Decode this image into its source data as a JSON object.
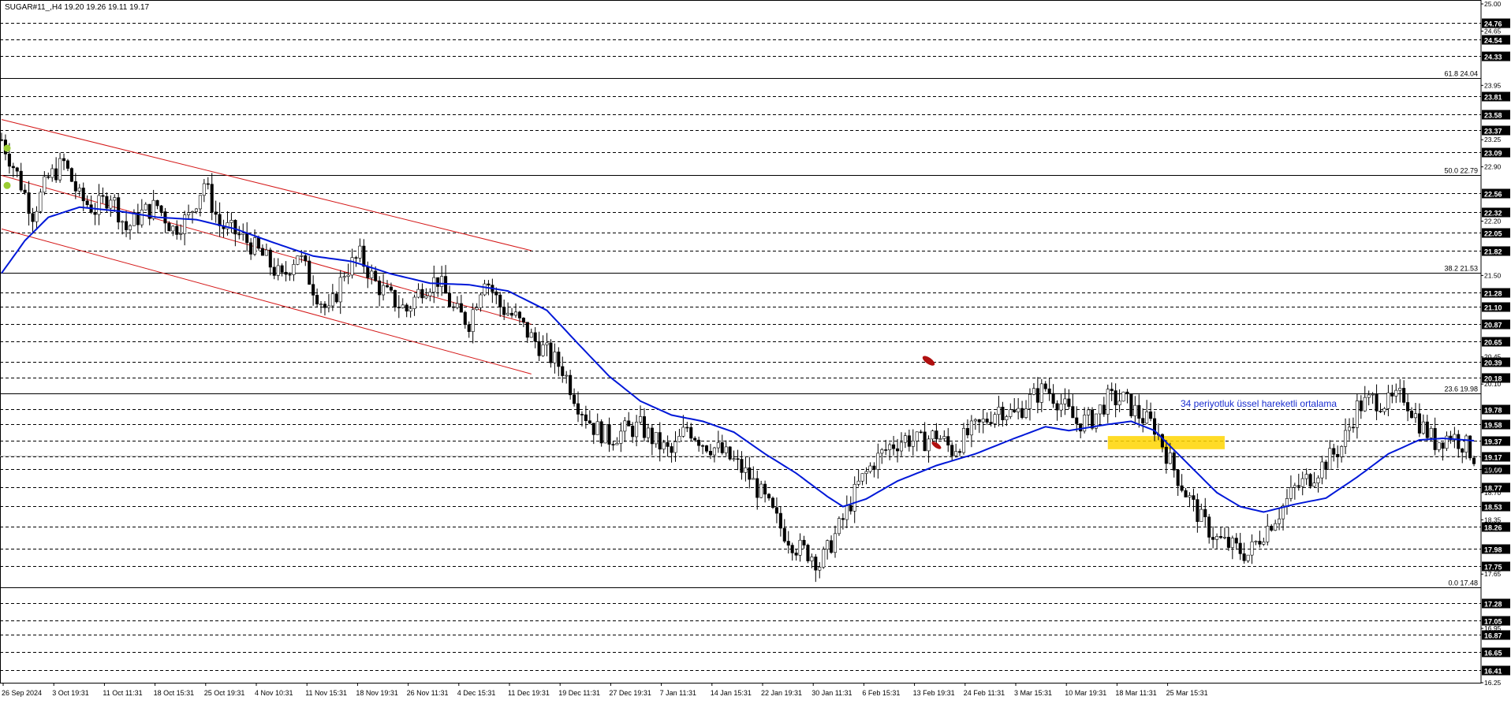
{
  "header": {
    "symbol_info": "SUGAR#11_,H4  19.20 19.26 19.11 19.17"
  },
  "annotation": {
    "text": "34 periyotluk üssel hareketli ortalama"
  },
  "colors": {
    "candle": "#000000",
    "ema": "#0018d8",
    "channel": "#d41818",
    "zone": "#ffd500",
    "price_box": "#000000",
    "grid": "#000000",
    "annotation": "#1a2fd0",
    "marker_green": "#9acd32",
    "marker_red": "#b01010"
  },
  "chart_data": {
    "type": "candlestick",
    "ylim": [
      16.25,
      25.0
    ],
    "grid": "dashed horizontal price levels",
    "x_tick_labels": [
      "26 Sep 2024",
      "3 Oct 19:31",
      "11 Oct 11:31",
      "18 Oct 15:31",
      "25 Oct 19:31",
      "4 Nov 10:31",
      "11 Nov 15:31",
      "18 Nov 19:31",
      "26 Nov 11:31",
      "4 Dec 15:31",
      "11 Dec 19:31",
      "19 Dec 11:31",
      "27 Dec 19:31",
      "7 Jan 11:31",
      "14 Jan 15:31",
      "22 Jan 19:31",
      "30 Jan 11:31",
      "6 Feb 15:31",
      "13 Feb 19:31",
      "24 Feb 11:31",
      "3 Mar 15:31",
      "10 Mar 19:31",
      "18 Mar 11:31",
      "25 Mar 15:31"
    ],
    "y_plain_ticks": [
      "25.00",
      "24.65",
      "23.95",
      "23.25",
      "22.90",
      "22.20",
      "21.50",
      "20.45",
      "20.10",
      "19.00",
      "18.70",
      "18.35",
      "17.65",
      "16.95",
      "16.25"
    ],
    "y_boxed_ticks": [
      "24.76",
      "24.54",
      "24.33",
      "23.81",
      "23.58",
      "23.37",
      "23.09",
      "22.56",
      "22.32",
      "22.05",
      "21.82",
      "21.28",
      "21.10",
      "20.87",
      "20.65",
      "20.39",
      "20.18",
      "19.78",
      "19.58",
      "19.37",
      "19.17",
      "19.00",
      "18.77",
      "18.53",
      "18.26",
      "17.98",
      "17.75",
      "17.28",
      "17.05",
      "16.87",
      "16.65",
      "16.41"
    ],
    "fib_levels": [
      {
        "label": "61.8 24.04",
        "value": 24.04
      },
      {
        "label": "50.0 22.79",
        "value": 22.79
      },
      {
        "label": "38.2 21.53",
        "value": 21.53
      },
      {
        "label": "23.6 19.98",
        "value": 19.98
      },
      {
        "label": "0.0 17.48",
        "value": 17.48
      }
    ],
    "current_price": 19.17,
    "price_path": [
      [
        0,
        23.25
      ],
      [
        4,
        22.8
      ],
      [
        8,
        22.3
      ],
      [
        12,
        22.75
      ],
      [
        16,
        22.95
      ],
      [
        20,
        22.5
      ],
      [
        24,
        22.35
      ],
      [
        28,
        22.55
      ],
      [
        32,
        22.1
      ],
      [
        36,
        22.3
      ],
      [
        40,
        22.4
      ],
      [
        44,
        22.1
      ],
      [
        48,
        22.25
      ],
      [
        52,
        22.7
      ],
      [
        56,
        22.15
      ],
      [
        60,
        22.05
      ],
      [
        64,
        21.9
      ],
      [
        68,
        21.7
      ],
      [
        72,
        21.45
      ],
      [
        76,
        21.8
      ],
      [
        80,
        21.35
      ],
      [
        84,
        21.0
      ],
      [
        88,
        21.55
      ],
      [
        92,
        21.75
      ],
      [
        96,
        21.4
      ],
      [
        100,
        21.2
      ],
      [
        104,
        21.05
      ],
      [
        108,
        21.35
      ],
      [
        112,
        21.45
      ],
      [
        116,
        21.05
      ],
      [
        120,
        20.9
      ],
      [
        124,
        21.5
      ],
      [
        128,
        21.1
      ],
      [
        132,
        20.95
      ],
      [
        136,
        20.7
      ],
      [
        140,
        20.5
      ],
      [
        144,
        20.3
      ],
      [
        148,
        19.85
      ],
      [
        152,
        19.55
      ],
      [
        156,
        19.4
      ],
      [
        160,
        19.5
      ],
      [
        164,
        19.55
      ],
      [
        168,
        19.35
      ],
      [
        172,
        19.2
      ],
      [
        176,
        19.55
      ],
      [
        180,
        19.35
      ],
      [
        184,
        19.25
      ],
      [
        188,
        19.1
      ],
      [
        192,
        18.9
      ],
      [
        196,
        18.6
      ],
      [
        200,
        18.25
      ],
      [
        204,
        18.0
      ],
      [
        208,
        17.9
      ],
      [
        210,
        17.78
      ],
      [
        212,
        17.95
      ],
      [
        216,
        18.35
      ],
      [
        220,
        18.8
      ],
      [
        224,
        19.1
      ],
      [
        228,
        19.3
      ],
      [
        232,
        19.4
      ],
      [
        236,
        19.35
      ],
      [
        240,
        19.45
      ],
      [
        244,
        19.25
      ],
      [
        248,
        19.45
      ],
      [
        252,
        19.6
      ],
      [
        256,
        19.8
      ],
      [
        260,
        19.7
      ],
      [
        264,
        19.9
      ],
      [
        268,
        20.05
      ],
      [
        272,
        19.85
      ],
      [
        276,
        19.6
      ],
      [
        280,
        19.65
      ],
      [
        284,
        19.9
      ],
      [
        288,
        19.9
      ],
      [
        292,
        19.7
      ],
      [
        296,
        19.55
      ],
      [
        300,
        19.1
      ],
      [
        304,
        18.7
      ],
      [
        308,
        18.35
      ],
      [
        312,
        18.1
      ],
      [
        316,
        18.0
      ],
      [
        320,
        17.9
      ],
      [
        324,
        18.2
      ],
      [
        328,
        18.45
      ],
      [
        332,
        18.75
      ],
      [
        336,
        18.9
      ],
      [
        340,
        19.1
      ],
      [
        344,
        19.3
      ],
      [
        348,
        19.8
      ],
      [
        352,
        19.9
      ],
      [
        356,
        19.85
      ],
      [
        360,
        19.95
      ],
      [
        364,
        19.6
      ],
      [
        368,
        19.35
      ],
      [
        372,
        19.45
      ],
      [
        376,
        19.3
      ],
      [
        378,
        19.17
      ]
    ],
    "ema_path": [
      [
        0,
        21.53
      ],
      [
        6,
        21.95
      ],
      [
        12,
        22.25
      ],
      [
        20,
        22.38
      ],
      [
        30,
        22.33
      ],
      [
        40,
        22.25
      ],
      [
        50,
        22.22
      ],
      [
        60,
        22.1
      ],
      [
        70,
        21.92
      ],
      [
        80,
        21.75
      ],
      [
        90,
        21.68
      ],
      [
        100,
        21.52
      ],
      [
        110,
        21.4
      ],
      [
        120,
        21.38
      ],
      [
        130,
        21.3
      ],
      [
        140,
        21.05
      ],
      [
        148,
        20.62
      ],
      [
        156,
        20.2
      ],
      [
        164,
        19.88
      ],
      [
        172,
        19.7
      ],
      [
        180,
        19.62
      ],
      [
        188,
        19.48
      ],
      [
        196,
        19.2
      ],
      [
        204,
        18.95
      ],
      [
        212,
        18.65
      ],
      [
        216,
        18.52
      ],
      [
        222,
        18.62
      ],
      [
        230,
        18.85
      ],
      [
        240,
        19.05
      ],
      [
        250,
        19.2
      ],
      [
        260,
        19.4
      ],
      [
        268,
        19.55
      ],
      [
        274,
        19.5
      ],
      [
        284,
        19.58
      ],
      [
        290,
        19.62
      ],
      [
        296,
        19.5
      ],
      [
        304,
        19.1
      ],
      [
        312,
        18.7
      ],
      [
        318,
        18.52
      ],
      [
        324,
        18.45
      ],
      [
        332,
        18.55
      ],
      [
        340,
        18.63
      ],
      [
        348,
        18.9
      ],
      [
        356,
        19.2
      ],
      [
        364,
        19.38
      ],
      [
        370,
        19.4
      ],
      [
        378,
        19.37
      ]
    ],
    "channel_lines": [
      {
        "x1": 0,
        "y1": 23.51,
        "x2": 136,
        "y2": 21.82
      },
      {
        "x1": 0,
        "y1": 22.79,
        "x2": 136,
        "y2": 20.87
      },
      {
        "x1": 0,
        "y1": 22.1,
        "x2": 136,
        "y2": 20.23
      }
    ],
    "zone": {
      "x_start": 284,
      "x_end": 314,
      "y_low": 19.26,
      "y_high": 19.43
    },
    "bar_count": 380
  }
}
